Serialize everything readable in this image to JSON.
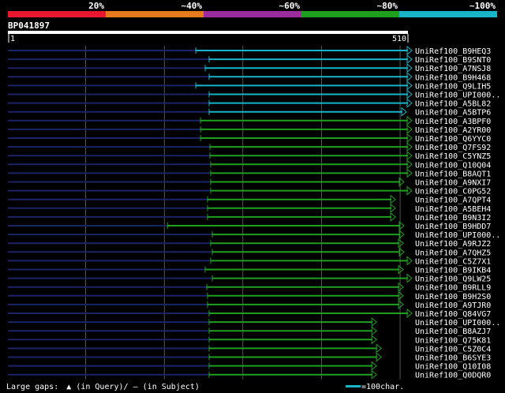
{
  "chart_data": {
    "type": "bar",
    "query_name": "BP041897",
    "query_length_label": "510",
    "query_start_label": "1",
    "identity_legend": [
      {
        "label": "",
        "color": "#e8162e"
      },
      {
        "label": "20%",
        "color": "#e8162e"
      },
      {
        "label": "~40%",
        "color": "#e87a1e"
      },
      {
        "label": "~60%",
        "color": "#9b2c9e"
      },
      {
        "label": "~80%",
        "color": "#1ea01e"
      },
      {
        "label": "~100%",
        "color": "#18b4c8"
      }
    ],
    "bar_colors": {
      "high": "#18b4c8",
      "mid": "#1ea01e",
      "unaligned": "#1a2466",
      "gridline": "#ffffff"
    },
    "x_range": [
      1,
      510
    ],
    "gridlines_at": [
      100,
      200,
      300,
      400,
      500
    ],
    "hits": [
      {
        "name": "UniRef100_B9HEQ3",
        "start": 240,
        "end": 515,
        "color": "high"
      },
      {
        "name": "UniRef100_B9SNT0",
        "start": 257,
        "end": 515,
        "color": "high"
      },
      {
        "name": "UniRef100_A7NSJ8",
        "start": 252,
        "end": 515,
        "color": "high"
      },
      {
        "name": "UniRef100_B9H468",
        "start": 257,
        "end": 515,
        "color": "high"
      },
      {
        "name": "UniRef100_Q9LIH5",
        "start": 240,
        "end": 515,
        "color": "high"
      },
      {
        "name": "UniRef100_UPI000..",
        "start": 257,
        "end": 515,
        "color": "high"
      },
      {
        "name": "UniRef100_A5BL82",
        "start": 257,
        "end": 515,
        "color": "high"
      },
      {
        "name": "UniRef100_A5BTP6",
        "start": 257,
        "end": 508,
        "color": "high"
      },
      {
        "name": "UniRef100_A3BPF0",
        "start": 246,
        "end": 515,
        "color": "mid"
      },
      {
        "name": "UniRef100_A2YR00",
        "start": 246,
        "end": 515,
        "color": "mid"
      },
      {
        "name": "UniRef100_Q6YYC0",
        "start": 246,
        "end": 515,
        "color": "mid"
      },
      {
        "name": "UniRef100_Q7FS92",
        "start": 258,
        "end": 515,
        "color": "mid"
      },
      {
        "name": "UniRef100_C5YNZ5",
        "start": 258,
        "end": 515,
        "color": "mid"
      },
      {
        "name": "UniRef100_Q10Q04",
        "start": 259,
        "end": 515,
        "color": "mid"
      },
      {
        "name": "UniRef100_B8AQT1",
        "start": 259,
        "end": 515,
        "color": "mid"
      },
      {
        "name": "UniRef100_A9NXI7",
        "start": 259,
        "end": 505,
        "color": "mid"
      },
      {
        "name": "UniRef100_C0PG52",
        "start": 259,
        "end": 515,
        "color": "mid"
      },
      {
        "name": "UniRef100_A7QPT4",
        "start": 255,
        "end": 494,
        "color": "mid"
      },
      {
        "name": "UniRef100_A5BEH4",
        "start": 255,
        "end": 494,
        "color": "mid"
      },
      {
        "name": "UniRef100_B9N3I2",
        "start": 255,
        "end": 494,
        "color": "mid"
      },
      {
        "name": "UniRef100_B9HDD7",
        "start": 204,
        "end": 505,
        "color": "mid"
      },
      {
        "name": "UniRef100_UPI000..",
        "start": 261,
        "end": 505,
        "color": "mid"
      },
      {
        "name": "UniRef100_A9RJZ2",
        "start": 259,
        "end": 504,
        "color": "mid"
      },
      {
        "name": "UniRef100_A7QHZ5",
        "start": 261,
        "end": 505,
        "color": "mid"
      },
      {
        "name": "UniRef100_C5Z7X1",
        "start": 259,
        "end": 515,
        "color": "mid"
      },
      {
        "name": "UniRef100_B9IKB4",
        "start": 252,
        "end": 504,
        "color": "mid"
      },
      {
        "name": "UniRef100_Q9LW25",
        "start": 261,
        "end": 515,
        "color": "mid"
      },
      {
        "name": "UniRef100_B9RLL9",
        "start": 254,
        "end": 504,
        "color": "mid"
      },
      {
        "name": "UniRef100_B9H2S0",
        "start": 255,
        "end": 504,
        "color": "mid"
      },
      {
        "name": "UniRef100_A9TJR0",
        "start": 255,
        "end": 504,
        "color": "mid"
      },
      {
        "name": "UniRef100_Q84VG7",
        "start": 257,
        "end": 515,
        "color": "mid"
      },
      {
        "name": "UniRef100_UPI000..",
        "start": 257,
        "end": 470,
        "color": "mid"
      },
      {
        "name": "UniRef100_B8AZJ7",
        "start": 257,
        "end": 470,
        "color": "mid"
      },
      {
        "name": "UniRef100_Q75K81",
        "start": 257,
        "end": 470,
        "color": "mid"
      },
      {
        "name": "UniRef100_C5Z0C4",
        "start": 257,
        "end": 476,
        "color": "mid"
      },
      {
        "name": "UniRef100_B6SYE3",
        "start": 257,
        "end": 476,
        "color": "mid"
      },
      {
        "name": "UniRef100_Q10I08",
        "start": 257,
        "end": 470,
        "color": "mid"
      },
      {
        "name": "UniRef100_Q0DQR0",
        "start": 257,
        "end": 470,
        "color": "mid"
      }
    ]
  },
  "footer": {
    "gaps_prefix": "Large gaps:",
    "gaps_query_marker": "▲",
    "gaps_query_text": "(in Query)/",
    "gaps_subject_marker": "―",
    "gaps_subject_text": "(in Subject)",
    "scale_text": "=100char."
  }
}
